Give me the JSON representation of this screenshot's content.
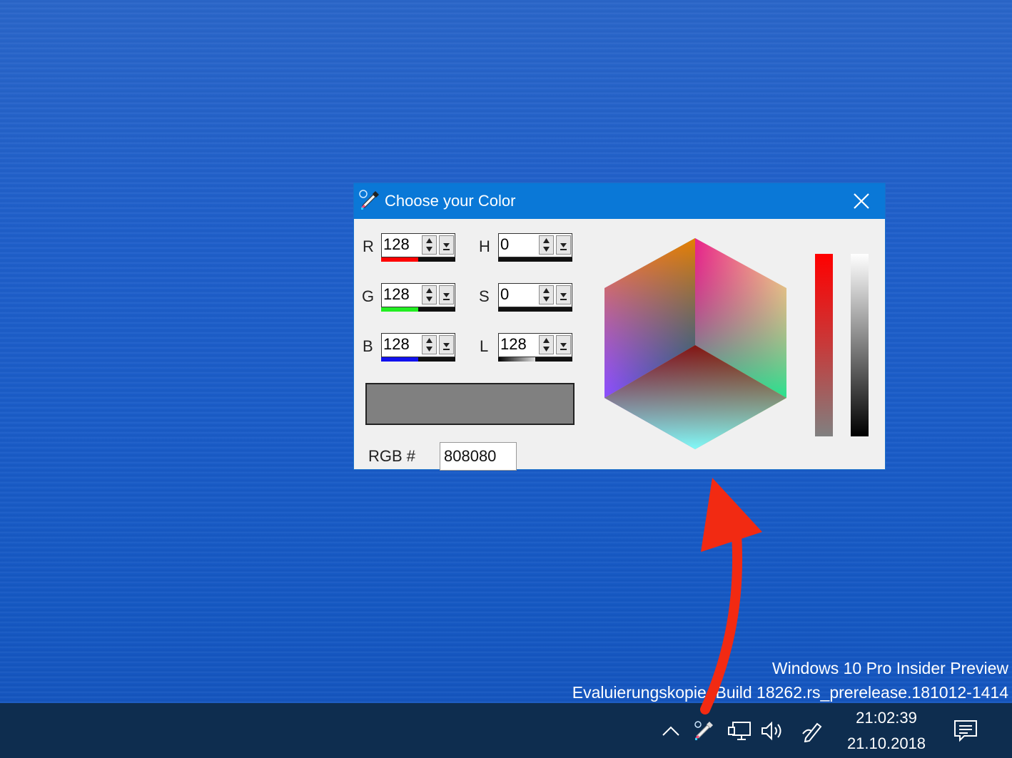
{
  "dialog": {
    "title": "Choose your Color",
    "fields": {
      "r": {
        "label": "R",
        "value": "128",
        "level": 0.502
      },
      "g": {
        "label": "G",
        "value": "128",
        "level": 0.502
      },
      "b": {
        "label": "B",
        "value": "128",
        "level": 0.502
      },
      "h": {
        "label": "H",
        "value": "0",
        "level": 0
      },
      "s": {
        "label": "S",
        "value": "0",
        "level": 0
      },
      "l": {
        "label": "L",
        "value": "128",
        "level": 0.502
      }
    },
    "preview_color": "#808080",
    "rgb_label": "RGB #",
    "rgb_value": "808080"
  },
  "watermark": {
    "line1": "Windows 10 Pro Insider Preview",
    "line2": "Evaluierungskopie. Build 18262.rs_prerelease.181012-1414"
  },
  "taskbar": {
    "time": "21:02:39",
    "date": "21.10.2018",
    "tray_icons": [
      "chevron-up-icon",
      "color-picker-icon",
      "network-icon",
      "volume-icon",
      "pen-icon",
      "notification-icon"
    ]
  },
  "colors": {
    "title_bar": "#0a78d7",
    "taskbar": "#0e2d4f",
    "arrow": "#f22a12"
  }
}
